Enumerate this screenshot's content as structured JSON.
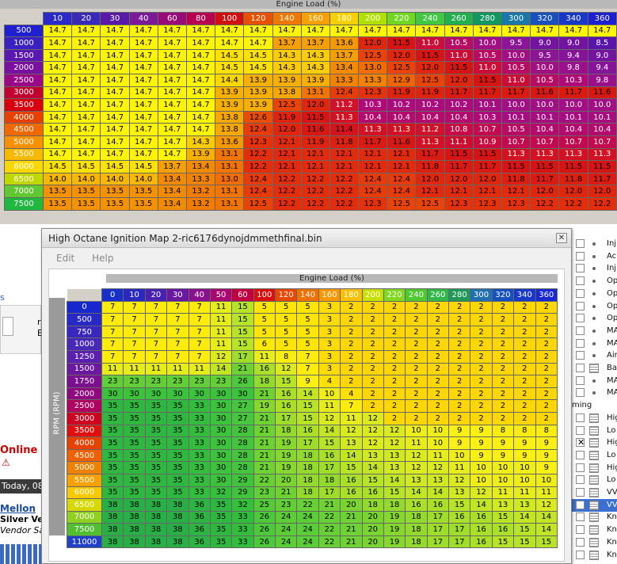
{
  "top_map": {
    "axis_title": "Engine Load (%)",
    "load_cols": [
      "10",
      "20",
      "30",
      "40",
      "60",
      "80",
      "100",
      "120",
      "140",
      "160",
      "180",
      "200",
      "220",
      "240",
      "260",
      "280",
      "300",
      "320",
      "340",
      "360"
    ],
    "col_colors": [
      "#2a2ac8",
      "#3a2ab8",
      "#5a1aa8",
      "#7a1a98",
      "#9a0a78",
      "#b80050",
      "#d01010",
      "#e85000",
      "#f07800",
      "#f8a000",
      "#f8d000",
      "#b0e000",
      "#70d820",
      "#40c840",
      "#20b050",
      "#109860",
      "#1878a8",
      "#1850c0",
      "#1838c8",
      "#1c20d0"
    ],
    "rpm_rows": [
      "500",
      "1000",
      "1500",
      "2000",
      "2500",
      "3000",
      "3500",
      "4000",
      "4500",
      "5000",
      "5500",
      "6000",
      "6500",
      "7000",
      "7500"
    ],
    "row_colors": [
      "#2020d0",
      "#3a20c0",
      "#5a18b0",
      "#7a10a0",
      "#9a0888",
      "#c00030",
      "#d80010",
      "#e84000",
      "#f06800",
      "#f89000",
      "#f8b800",
      "#f8d800",
      "#c0d800",
      "#60c830",
      "#20b840"
    ],
    "values": [
      [
        "14.7",
        "14.7",
        "14.7",
        "14.7",
        "14.7",
        "14.7",
        "14.7",
        "14.7",
        "14.7",
        "14.7",
        "14.7",
        "14.7",
        "14.7",
        "14.7",
        "14.7",
        "14.7",
        "14.7",
        "14.7",
        "14.7",
        "14.7"
      ],
      [
        "14.7",
        "14.7",
        "14.7",
        "14.7",
        "14.7",
        "14.7",
        "14.7",
        "14.7",
        "13.7",
        "13.7",
        "13.6",
        "12.0",
        "11.5",
        "11.0",
        "10.5",
        "10.0",
        "9.5",
        "9.0",
        "9.0",
        "8.5"
      ],
      [
        "14.7",
        "14.7",
        "14.7",
        "14.7",
        "14.7",
        "14.7",
        "14.5",
        "14.5",
        "14.3",
        "14.3",
        "13.7",
        "12.5",
        "12.0",
        "11.5",
        "11.0",
        "10.5",
        "10.0",
        "9.5",
        "9.4",
        "9.0"
      ],
      [
        "14.7",
        "14.7",
        "14.7",
        "14.7",
        "14.7",
        "14.7",
        "14.5",
        "14.5",
        "14.3",
        "14.3",
        "13.4",
        "13.0",
        "12.5",
        "12.0",
        "11.5",
        "11.0",
        "10.5",
        "10.0",
        "9.8",
        "9.4"
      ],
      [
        "14.7",
        "14.7",
        "14.7",
        "14.7",
        "14.7",
        "14.7",
        "14.4",
        "13.9",
        "13.9",
        "13.9",
        "13.3",
        "13.3",
        "12.9",
        "12.5",
        "12.0",
        "11.5",
        "11.0",
        "10.5",
        "10.3",
        "9.8"
      ],
      [
        "14.7",
        "14.7",
        "14.7",
        "14.7",
        "14.7",
        "14.7",
        "13.9",
        "13.9",
        "13.8",
        "13.1",
        "12.4",
        "12.3",
        "11.9",
        "11.9",
        "11.7",
        "11.7",
        "11.7",
        "11.6",
        "11.7",
        "11.6"
      ],
      [
        "14.7",
        "14.7",
        "14.7",
        "14.7",
        "14.7",
        "14.7",
        "13.9",
        "13.9",
        "12.5",
        "12.0",
        "11.2",
        "10.3",
        "10.2",
        "10.2",
        "10.2",
        "10.1",
        "10.0",
        "10.0",
        "10.0",
        "10.0"
      ],
      [
        "14.7",
        "14.7",
        "14.7",
        "14.7",
        "14.7",
        "14.7",
        "13.8",
        "12.6",
        "11.9",
        "11.5",
        "11.3",
        "10.4",
        "10.4",
        "10.4",
        "10.4",
        "10.3",
        "10.1",
        "10.1",
        "10.1",
        "10.1"
      ],
      [
        "14.7",
        "14.7",
        "14.7",
        "14.7",
        "14.7",
        "14.7",
        "13.8",
        "12.4",
        "12.0",
        "11.6",
        "11.4",
        "11.3",
        "11.3",
        "11.2",
        "10.8",
        "10.7",
        "10.5",
        "10.4",
        "10.4",
        "10.4"
      ],
      [
        "14.7",
        "14.7",
        "14.7",
        "14.7",
        "14.7",
        "14.3",
        "13.6",
        "12.3",
        "12.1",
        "11.9",
        "11.8",
        "11.7",
        "11.6",
        "11.3",
        "11.1",
        "10.9",
        "10.7",
        "10.7",
        "10.7",
        "10.7"
      ],
      [
        "14.7",
        "14.7",
        "14.7",
        "14.7",
        "14.7",
        "13.9",
        "13.1",
        "12.2",
        "12.1",
        "12.1",
        "12.1",
        "12.1",
        "12.1",
        "11.7",
        "11.5",
        "11.5",
        "11.3",
        "11.3",
        "11.3",
        "11.3"
      ],
      [
        "14.5",
        "14.5",
        "14.5",
        "14.5",
        "13.7",
        "13.4",
        "13.1",
        "12.2",
        "12.1",
        "12.1",
        "12.1",
        "12.1",
        "12.1",
        "11.8",
        "11.7",
        "11.7",
        "11.5",
        "11.5",
        "11.5",
        "11.5"
      ],
      [
        "14.0",
        "14.0",
        "14.0",
        "14.0",
        "13.4",
        "13.3",
        "13.0",
        "12.4",
        "12.2",
        "12.2",
        "12.2",
        "12.4",
        "12.4",
        "12.0",
        "12.0",
        "12.0",
        "11.8",
        "11.7",
        "11.8",
        "11.7"
      ],
      [
        "13.5",
        "13.5",
        "13.5",
        "13.5",
        "13.4",
        "13.2",
        "13.1",
        "12.4",
        "12.2",
        "12.2",
        "12.2",
        "12.4",
        "12.4",
        "12.1",
        "12.1",
        "12.1",
        "12.1",
        "12.0",
        "12.0",
        "12.0"
      ],
      [
        "13.5",
        "13.5",
        "13.5",
        "13.5",
        "13.4",
        "13.2",
        "13.1",
        "12.5",
        "12.2",
        "12.2",
        "12.2",
        "12.3",
        "12.5",
        "12.5",
        "12.3",
        "12.3",
        "12.3",
        "12.2",
        "12.2",
        "12.2"
      ]
    ]
  },
  "window": {
    "title": "High Octane Ignition Map 2-ric6176dynojdmmethfinal.bin",
    "close_label": "✕",
    "menu": [
      "Edit",
      "Help"
    ],
    "axis_title": "Engine Load (%)",
    "rpm_axis_label": "RPM (RPM)",
    "load_cols": [
      "0",
      "10",
      "20",
      "30",
      "40",
      "50",
      "60",
      "100",
      "120",
      "140",
      "160",
      "180",
      "200",
      "220",
      "240",
      "260",
      "280",
      "300",
      "320",
      "340",
      "360"
    ],
    "col_colors": [
      "#1830c8",
      "#2a28c0",
      "#4a20b0",
      "#6a18a0",
      "#8a1090",
      "#a80870",
      "#c00040",
      "#d81010",
      "#e84800",
      "#f07000",
      "#f89800",
      "#f8c000",
      "#c8e000",
      "#80d820",
      "#50c830",
      "#30b848",
      "#209858",
      "#2070b0",
      "#1850c0",
      "#1838c8",
      "#1828d0"
    ],
    "rpm_rows": [
      "0",
      "500",
      "750",
      "1000",
      "1250",
      "1500",
      "1750",
      "2000",
      "2500",
      "3000",
      "3500",
      "4000",
      "4500",
      "5000",
      "5500",
      "6000",
      "6500",
      "7000",
      "7500",
      "11000"
    ],
    "row_colors": [
      "#1828d0",
      "#2828c8",
      "#3828c0",
      "#4828b8",
      "#5a20b0",
      "#6a18a0",
      "#7a1090",
      "#900880",
      "#b00060",
      "#d00020",
      "#e01010",
      "#e84000",
      "#f06000",
      "#f08000",
      "#f8a000",
      "#f8c800",
      "#d8d800",
      "#90d020",
      "#50c030",
      "#2040c8"
    ],
    "values": [
      [
        "7",
        "7",
        "7",
        "7",
        "7",
        "11",
        "15",
        "5",
        "5",
        "5",
        "3",
        "2",
        "2",
        "2",
        "2",
        "2",
        "2",
        "2",
        "2",
        "2",
        "2"
      ],
      [
        "7",
        "7",
        "7",
        "7",
        "7",
        "11",
        "15",
        "5",
        "5",
        "5",
        "3",
        "2",
        "2",
        "2",
        "2",
        "2",
        "2",
        "2",
        "2",
        "2",
        "2"
      ],
      [
        "7",
        "7",
        "7",
        "7",
        "7",
        "11",
        "15",
        "5",
        "5",
        "5",
        "3",
        "2",
        "2",
        "2",
        "2",
        "2",
        "2",
        "2",
        "2",
        "2",
        "2"
      ],
      [
        "7",
        "7",
        "7",
        "7",
        "7",
        "11",
        "15",
        "6",
        "5",
        "5",
        "3",
        "2",
        "2",
        "2",
        "2",
        "2",
        "2",
        "2",
        "2",
        "2",
        "2"
      ],
      [
        "7",
        "7",
        "7",
        "7",
        "7",
        "12",
        "17",
        "11",
        "8",
        "7",
        "3",
        "2",
        "2",
        "2",
        "2",
        "2",
        "2",
        "2",
        "2",
        "2",
        "2"
      ],
      [
        "11",
        "11",
        "11",
        "11",
        "11",
        "14",
        "21",
        "16",
        "12",
        "7",
        "3",
        "2",
        "2",
        "2",
        "2",
        "2",
        "2",
        "2",
        "2",
        "2",
        "2"
      ],
      [
        "23",
        "23",
        "23",
        "23",
        "23",
        "23",
        "26",
        "18",
        "15",
        "9",
        "4",
        "2",
        "2",
        "2",
        "2",
        "2",
        "2",
        "2",
        "2",
        "2",
        "2"
      ],
      [
        "30",
        "30",
        "30",
        "30",
        "30",
        "30",
        "30",
        "21",
        "16",
        "14",
        "10",
        "4",
        "2",
        "2",
        "2",
        "2",
        "2",
        "2",
        "2",
        "2",
        "2"
      ],
      [
        "35",
        "35",
        "35",
        "35",
        "33",
        "30",
        "27",
        "19",
        "16",
        "15",
        "11",
        "7",
        "2",
        "2",
        "2",
        "2",
        "2",
        "2",
        "2",
        "2",
        "2"
      ],
      [
        "35",
        "35",
        "35",
        "35",
        "33",
        "30",
        "27",
        "21",
        "17",
        "15",
        "12",
        "11",
        "12",
        "2",
        "2",
        "2",
        "2",
        "2",
        "2",
        "2",
        "2"
      ],
      [
        "35",
        "35",
        "35",
        "35",
        "33",
        "30",
        "28",
        "21",
        "18",
        "16",
        "14",
        "12",
        "12",
        "12",
        "10",
        "10",
        "9",
        "9",
        "8",
        "8",
        "8"
      ],
      [
        "35",
        "35",
        "35",
        "35",
        "33",
        "30",
        "28",
        "21",
        "19",
        "17",
        "15",
        "13",
        "12",
        "12",
        "11",
        "10",
        "9",
        "9",
        "9",
        "9",
        "9"
      ],
      [
        "35",
        "35",
        "35",
        "35",
        "33",
        "30",
        "28",
        "21",
        "19",
        "18",
        "16",
        "14",
        "13",
        "13",
        "12",
        "11",
        "10",
        "9",
        "9",
        "9",
        "9"
      ],
      [
        "35",
        "35",
        "35",
        "35",
        "33",
        "30",
        "28",
        "21",
        "19",
        "18",
        "17",
        "15",
        "14",
        "13",
        "12",
        "12",
        "11",
        "10",
        "10",
        "10",
        "9"
      ],
      [
        "35",
        "35",
        "35",
        "35",
        "33",
        "30",
        "29",
        "22",
        "20",
        "18",
        "18",
        "16",
        "15",
        "14",
        "13",
        "13",
        "12",
        "10",
        "10",
        "10",
        "10"
      ],
      [
        "35",
        "35",
        "35",
        "35",
        "33",
        "32",
        "29",
        "23",
        "21",
        "18",
        "17",
        "16",
        "16",
        "15",
        "14",
        "14",
        "13",
        "12",
        "11",
        "11",
        "11"
      ],
      [
        "38",
        "38",
        "38",
        "38",
        "36",
        "35",
        "32",
        "25",
        "23",
        "22",
        "21",
        "20",
        "18",
        "18",
        "16",
        "16",
        "15",
        "14",
        "13",
        "13",
        "12"
      ],
      [
        "38",
        "38",
        "38",
        "38",
        "36",
        "35",
        "33",
        "26",
        "24",
        "24",
        "22",
        "21",
        "20",
        "19",
        "18",
        "17",
        "16",
        "16",
        "15",
        "14",
        "14"
      ],
      [
        "38",
        "38",
        "38",
        "38",
        "36",
        "35",
        "33",
        "26",
        "24",
        "24",
        "22",
        "21",
        "20",
        "19",
        "18",
        "17",
        "17",
        "16",
        "16",
        "15",
        "14"
      ],
      [
        "38",
        "38",
        "38",
        "38",
        "36",
        "35",
        "33",
        "26",
        "24",
        "24",
        "22",
        "21",
        "20",
        "19",
        "18",
        "17",
        "17",
        "16",
        "15",
        "15",
        "15"
      ]
    ]
  },
  "right_pane": [
    {
      "label": "Inj",
      "check": false,
      "grid": false
    },
    {
      "label": "Ac",
      "check": true,
      "grid": false
    },
    {
      "label": "Inj",
      "check": false,
      "grid": false
    },
    {
      "label": "Op",
      "check": true,
      "grid": false
    },
    {
      "label": "Op",
      "check": true,
      "grid": false
    },
    {
      "label": "Op",
      "check": true,
      "grid": false
    },
    {
      "label": "Op",
      "check": true,
      "grid": false
    },
    {
      "label": "MA",
      "check": true,
      "grid": false
    },
    {
      "label": "MA",
      "check": true,
      "grid": false
    },
    {
      "label": "Air",
      "check": true,
      "grid": false
    },
    {
      "label": "Ba",
      "check": false,
      "grid": true
    },
    {
      "label": "MA",
      "check": false,
      "grid": false
    },
    {
      "label": "MA",
      "check": false,
      "grid": false
    },
    {
      "label": "ming",
      "check": false,
      "grid": false
    },
    {
      "label": "Hig",
      "check": false,
      "grid": true
    },
    {
      "label": "Lo",
      "check": false,
      "grid": true
    },
    {
      "label": "Hig",
      "check": true,
      "grid": true
    },
    {
      "label": "Lo",
      "check": false,
      "grid": true
    },
    {
      "label": "Hig",
      "check": false,
      "grid": true
    },
    {
      "label": "Lo",
      "check": false,
      "grid": true
    },
    {
      "label": "VV",
      "check": false,
      "grid": true
    },
    {
      "label": "VV",
      "check": false,
      "grid": true
    },
    {
      "label": "Kn",
      "check": false,
      "grid": true
    },
    {
      "label": "Kn",
      "check": false,
      "grid": true
    },
    {
      "label": "Kn",
      "check": false,
      "grid": true
    },
    {
      "label": "Kn",
      "check": false,
      "grid": true
    }
  ],
  "left_pane": {
    "frag1": "s",
    "frag2": "r",
    "frag3": "E",
    "online": "Online",
    "warn": "⚠",
    "today": "Today, 08",
    "user": "Mellon",
    "rank": "Silver Ven",
    "vendor": "Vendor Sa"
  }
}
